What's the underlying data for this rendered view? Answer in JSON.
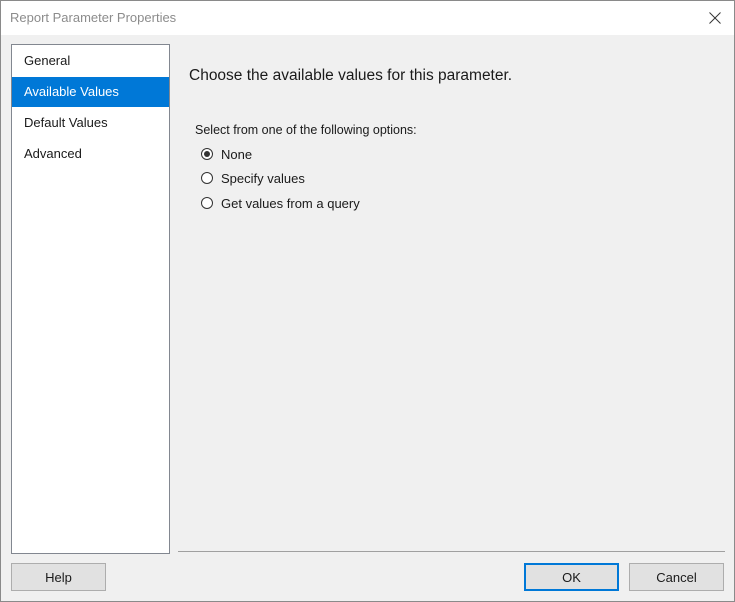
{
  "window": {
    "title": "Report Parameter Properties"
  },
  "nav": {
    "items": [
      {
        "label": "General",
        "selected": false
      },
      {
        "label": "Available Values",
        "selected": true
      },
      {
        "label": "Default Values",
        "selected": false
      },
      {
        "label": "Advanced",
        "selected": false
      }
    ]
  },
  "main": {
    "heading": "Choose the available values for this parameter.",
    "options_label": "Select from one of the following options:",
    "options": [
      {
        "label": "None",
        "checked": true
      },
      {
        "label": "Specify values",
        "checked": false
      },
      {
        "label": "Get values from a query",
        "checked": false
      }
    ]
  },
  "footer": {
    "help_label": "Help",
    "ok_label": "OK",
    "cancel_label": "Cancel"
  },
  "colors": {
    "accent": "#0078d7",
    "dialog_background": "#f0f0f0",
    "title_text": "#8c8c8c"
  }
}
